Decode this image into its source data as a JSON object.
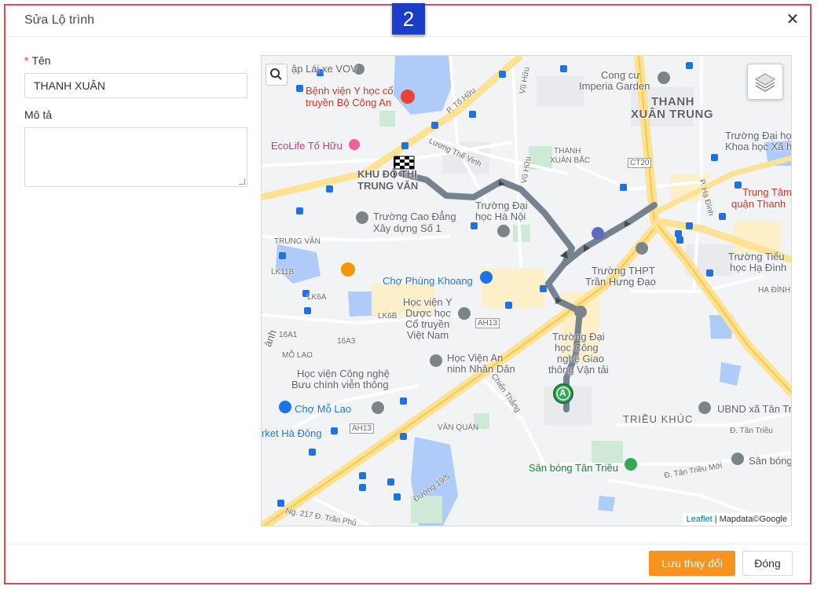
{
  "modal": {
    "title": "Sửa Lộ trình",
    "close_glyph": "✕",
    "step_badge": "2"
  },
  "form": {
    "name_label": "Tên",
    "required_mark": "*",
    "name_value": "THANH XUÂN",
    "description_label": "Mô tả",
    "description_value": ""
  },
  "map": {
    "attribution_leaflet": "Leaflet",
    "attribution_rest": " | Mapdata©Google",
    "start_marker": "A",
    "labels": {
      "l1": "ập Lái xe VOV",
      "l2": "Bệnh viện Y học cổ",
      "l3": "truyền Bộ Công An",
      "l4": "EcoLife Tố Hữu",
      "l5": "KHU ĐÔ THỊ",
      "l6": "TRUNG VĂN",
      "l7": "Trường Cao Đẳng",
      "l8": "Xây dựng Số 1",
      "l9": "TRUNG VĂN",
      "l10": "Chợ Phùng Khoang",
      "l11": "Học viện Y",
      "l12": "Dược học",
      "l13": "Cổ truyền",
      "l14": "Việt Nam",
      "l15": "Học viện Công nghệ",
      "l16": "Bưu chính viễn thông",
      "l17": "Chợ Mỗ Lao",
      "l18": "rket Hà Đông",
      "l19": "MỖ LAO",
      "l20": "VĂN QUÁN",
      "l21": "Học Viện An",
      "l22": "ninh Nhân Dân",
      "l23": "Trường Đại",
      "l24": "học Hà Nội",
      "l25": "Trường Đại",
      "l26": "học Công",
      "l27": "nghệ Giao",
      "l28": "thông Vận tải",
      "l29": "Trường THPT",
      "l30": "Trần Hưng Đạo",
      "l31": "THANH",
      "l32": "XUÂN TRUNG",
      "l33": "THANH",
      "l34": "XUÂN BẮC",
      "l35": "Cong cư",
      "l36": "Imperia Garden",
      "l37": "Trường Đại học",
      "l38": "Khoa học Xã h",
      "l39": "Trung Tâm",
      "l40": "quận Thanh",
      "l41": "Trường Tiểu",
      "l42": "học Hạ Đình",
      "l43": "HẠ ĐÌNH",
      "l44": "TRIỀU KHÚC",
      "l45": "UBND xã Tân Tr",
      "l46": "Sân bóng Tân Triều",
      "l47": "Sân bóng",
      "l48": "Chiến Thắng",
      "l49": "P. Tố Hữu",
      "l50": "Lương Thế Vinh",
      "l51": "Vũ Hữu",
      "l52": "Đ. Tân Triều",
      "l53": "Đ. Tân Triều Mới",
      "l54": "Đường 19/5",
      "l55": "Ng. 217 Đ. Trần Phú",
      "l56": "P. Hạ Đình",
      "l57": "AH13",
      "l58": "AH13",
      "l59": "CT20",
      "l60": "LK11B",
      "l61": "LK6A",
      "l62": "LK6B",
      "l63": "16A1",
      "l64": "16A3",
      "l65": "Vũ Hữu",
      "l66": "ành"
    }
  },
  "footer": {
    "save_label": "Lưu thay đổi",
    "close_label": "Đóng"
  },
  "colors": {
    "frame_border": "#e8474f",
    "primary": "#f7931e",
    "badge": "#1b3ec8",
    "route": "#74838d"
  }
}
